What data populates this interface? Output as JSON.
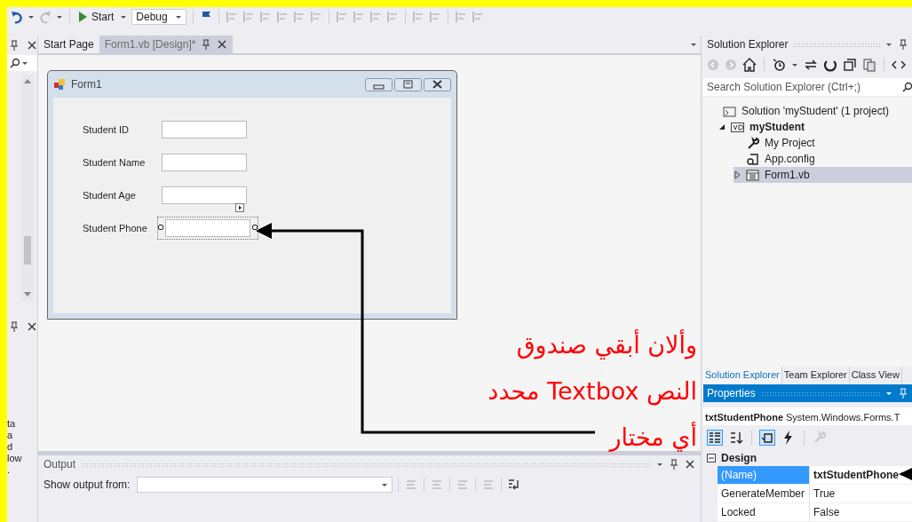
{
  "toolbar": {
    "start_label": "Start",
    "configuration": "Debug"
  },
  "left_panel": {
    "fragments": [
      "ta",
      "a",
      "d",
      "low",
      "."
    ]
  },
  "doc_tabs": [
    {
      "label": "Start Page",
      "selected": false
    },
    {
      "label": "Form1.vb [Design]*",
      "selected": true
    }
  ],
  "form": {
    "title": "Form1",
    "fields": [
      {
        "label": "Student ID",
        "selected": false
      },
      {
        "label": "Student Name",
        "selected": false
      },
      {
        "label": "Student Age",
        "selected": false
      },
      {
        "label": "Student Phone",
        "selected": true
      }
    ]
  },
  "annotation": {
    "lines": [
      "وألان أبقي صندوق",
      "النص Textbox محدد",
      "أي مختار"
    ]
  },
  "output": {
    "title": "Output",
    "show_from_label": "Show output from:"
  },
  "solution_explorer": {
    "title": "Solution Explorer",
    "search_placeholder": "Search Solution Explorer (Ctrl+;)",
    "tree": [
      {
        "label": "Solution 'myStudent' (1 project)",
        "kind": "solution",
        "bold": false,
        "selected": false,
        "children": [
          {
            "label": "myStudent",
            "kind": "project",
            "bold": true,
            "selected": false,
            "expanded": true,
            "children": [
              {
                "label": "My Project",
                "kind": "settings",
                "bold": false,
                "selected": false
              },
              {
                "label": "App.config",
                "kind": "config",
                "bold": false,
                "selected": false
              },
              {
                "label": "Form1.vb",
                "kind": "form",
                "bold": false,
                "selected": true,
                "expanded": false
              }
            ]
          }
        ]
      }
    ]
  },
  "panel_tabs": [
    {
      "label": "Solution Explorer",
      "selected": true
    },
    {
      "label": "Team Explorer",
      "selected": false
    },
    {
      "label": "Class View",
      "selected": false
    }
  ],
  "properties": {
    "title": "Properties",
    "object_name": "txtStudentPhone",
    "object_type": "System.Windows.Forms.T",
    "category": "Design",
    "rows": [
      {
        "name": "(Name)",
        "value": "txtStudentPhone",
        "selected": true,
        "modified": true
      },
      {
        "name": "GenerateMember",
        "value": "True",
        "selected": false,
        "modified": false
      },
      {
        "name": "Locked",
        "value": "False",
        "selected": false,
        "modified": false
      }
    ]
  }
}
